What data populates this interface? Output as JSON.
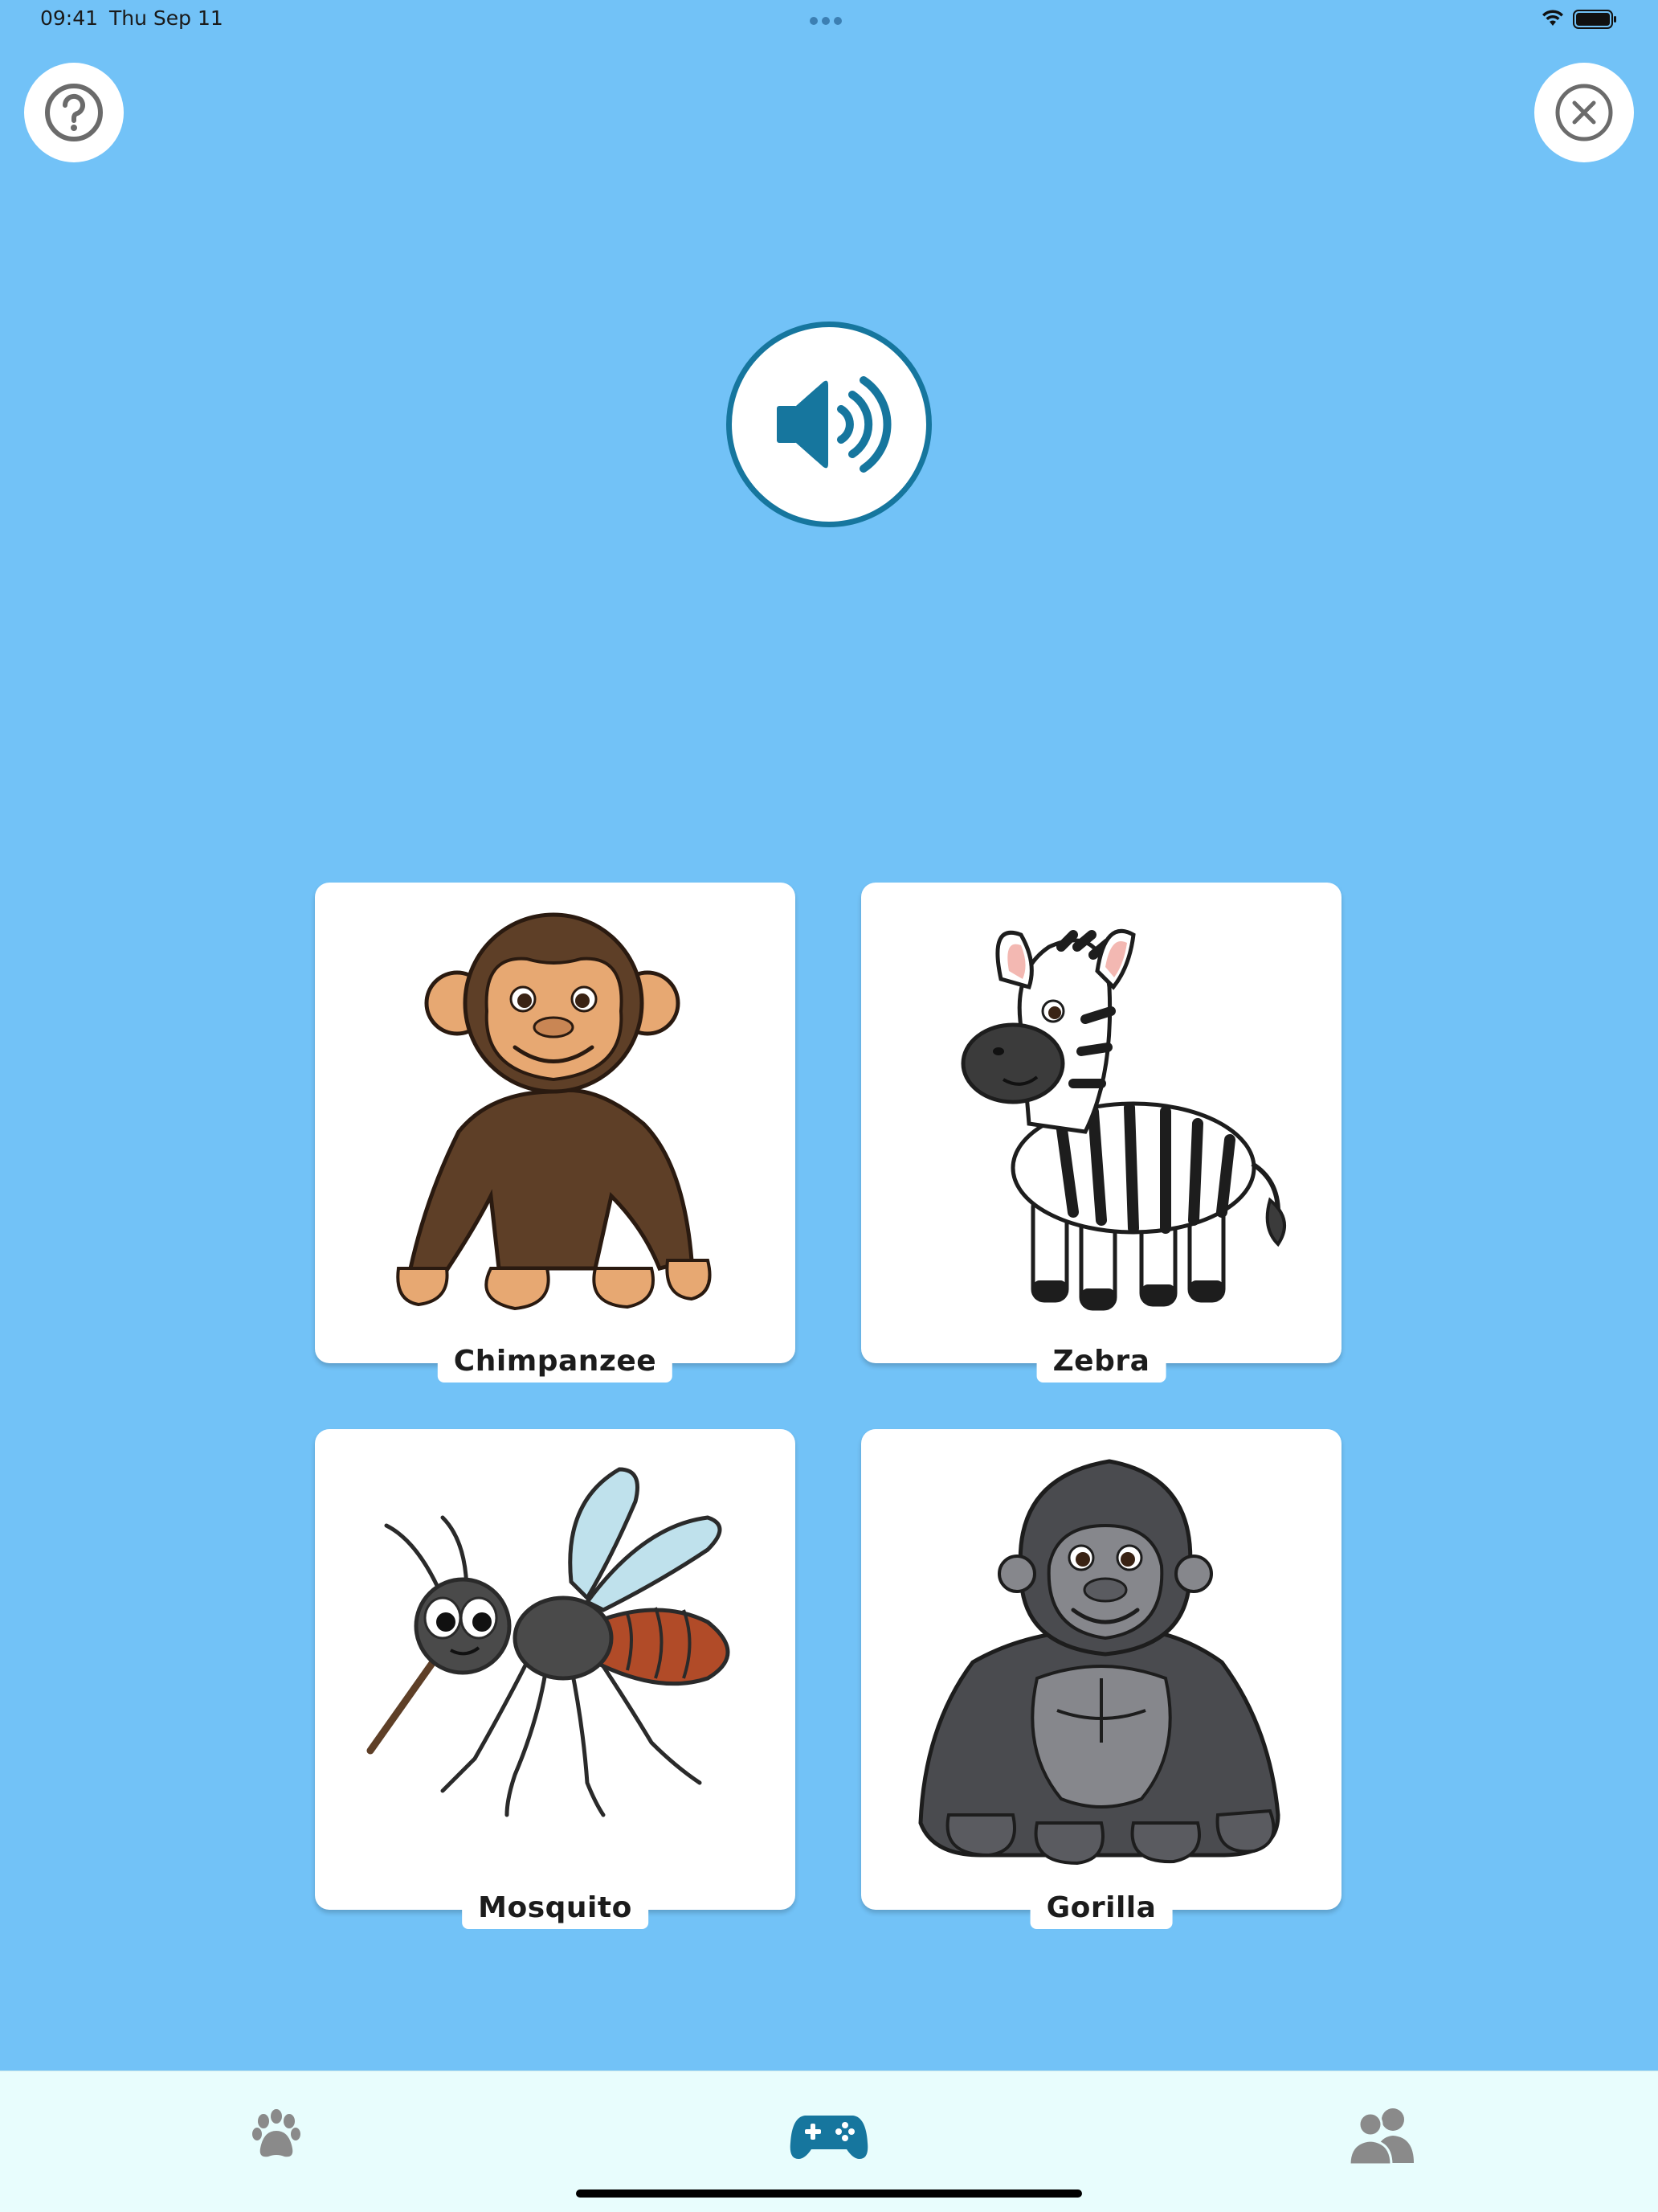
{
  "status_bar": {
    "time": "09:41",
    "date": "Thu Sep 11",
    "wifi_icon": "wifi-icon",
    "battery_icon": "battery-full-icon"
  },
  "top_controls": {
    "help_icon": "question-circle-icon",
    "close_icon": "close-circle-icon"
  },
  "speaker": {
    "icon": "speaker-volume-icon",
    "accent_color": "#16769E"
  },
  "cards": [
    {
      "label": "Chimpanzee",
      "icon": "chimpanzee-illustration"
    },
    {
      "label": "Zebra",
      "icon": "zebra-illustration"
    },
    {
      "label": "Mosquito",
      "icon": "mosquito-illustration"
    },
    {
      "label": "Gorilla",
      "icon": "gorilla-illustration"
    }
  ],
  "tab_bar": {
    "tabs": [
      {
        "icon": "paw-icon",
        "active": false
      },
      {
        "icon": "gamepad-icon",
        "active": true
      },
      {
        "icon": "users-icon",
        "active": false
      }
    ],
    "active_color": "#16769E",
    "inactive_color": "#8A8A8A"
  },
  "colors": {
    "background": "#72C2F7",
    "tab_bar_background": "#E8FDFD"
  }
}
